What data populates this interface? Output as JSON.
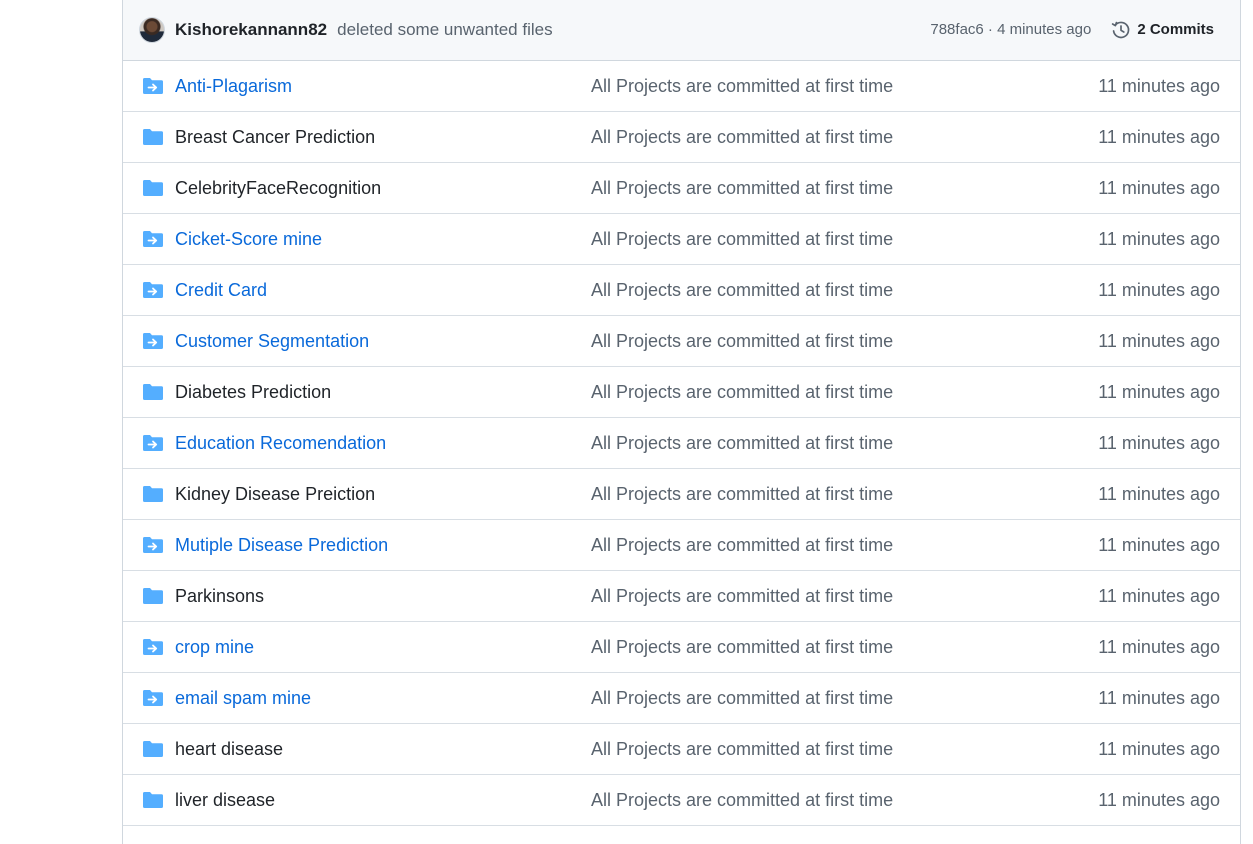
{
  "commit": {
    "author": "Kishorekannann82",
    "message": "deleted some unwanted files",
    "meta": "788fac6 · 4 minutes ago",
    "commits_label": "2 Commits",
    "avatar_icon": "avatar-photo",
    "history_icon": "history-icon"
  },
  "colors": {
    "link": "#0969da",
    "folder": "#54aeff",
    "muted": "#59636e",
    "border": "#d0d7de",
    "header_bg": "#f6f8fa"
  },
  "files": [
    {
      "name": "Anti-Plagarism",
      "type": "submodule",
      "message": "All Projects are committed at first time",
      "age": "11 minutes ago"
    },
    {
      "name": "Breast Cancer Prediction",
      "type": "folder",
      "message": "All Projects are committed at first time",
      "age": "11 minutes ago"
    },
    {
      "name": "CelebrityFaceRecognition",
      "type": "folder",
      "message": "All Projects are committed at first time",
      "age": "11 minutes ago"
    },
    {
      "name": "Cicket-Score mine",
      "type": "submodule",
      "message": "All Projects are committed at first time",
      "age": "11 minutes ago"
    },
    {
      "name": "Credit Card",
      "type": "submodule",
      "message": "All Projects are committed at first time",
      "age": "11 minutes ago"
    },
    {
      "name": "Customer Segmentation",
      "type": "submodule",
      "message": "All Projects are committed at first time",
      "age": "11 minutes ago"
    },
    {
      "name": "Diabetes Prediction",
      "type": "folder",
      "message": "All Projects are committed at first time",
      "age": "11 minutes ago"
    },
    {
      "name": "Education Recomendation",
      "type": "submodule",
      "message": "All Projects are committed at first time",
      "age": "11 minutes ago"
    },
    {
      "name": "Kidney Disease Preiction",
      "type": "folder",
      "message": "All Projects are committed at first time",
      "age": "11 minutes ago"
    },
    {
      "name": "Mutiple Disease Prediction",
      "type": "submodule",
      "message": "All Projects are committed at first time",
      "age": "11 minutes ago"
    },
    {
      "name": "Parkinsons",
      "type": "folder",
      "message": "All Projects are committed at first time",
      "age": "11 minutes ago"
    },
    {
      "name": "crop mine",
      "type": "submodule",
      "message": "All Projects are committed at first time",
      "age": "11 minutes ago"
    },
    {
      "name": "email spam mine",
      "type": "submodule",
      "message": "All Projects are committed at first time",
      "age": "11 minutes ago"
    },
    {
      "name": "heart disease",
      "type": "folder",
      "message": "All Projects are committed at first time",
      "age": "11 minutes ago"
    },
    {
      "name": "liver disease",
      "type": "folder",
      "message": "All Projects are committed at first time",
      "age": "11 minutes ago"
    }
  ]
}
